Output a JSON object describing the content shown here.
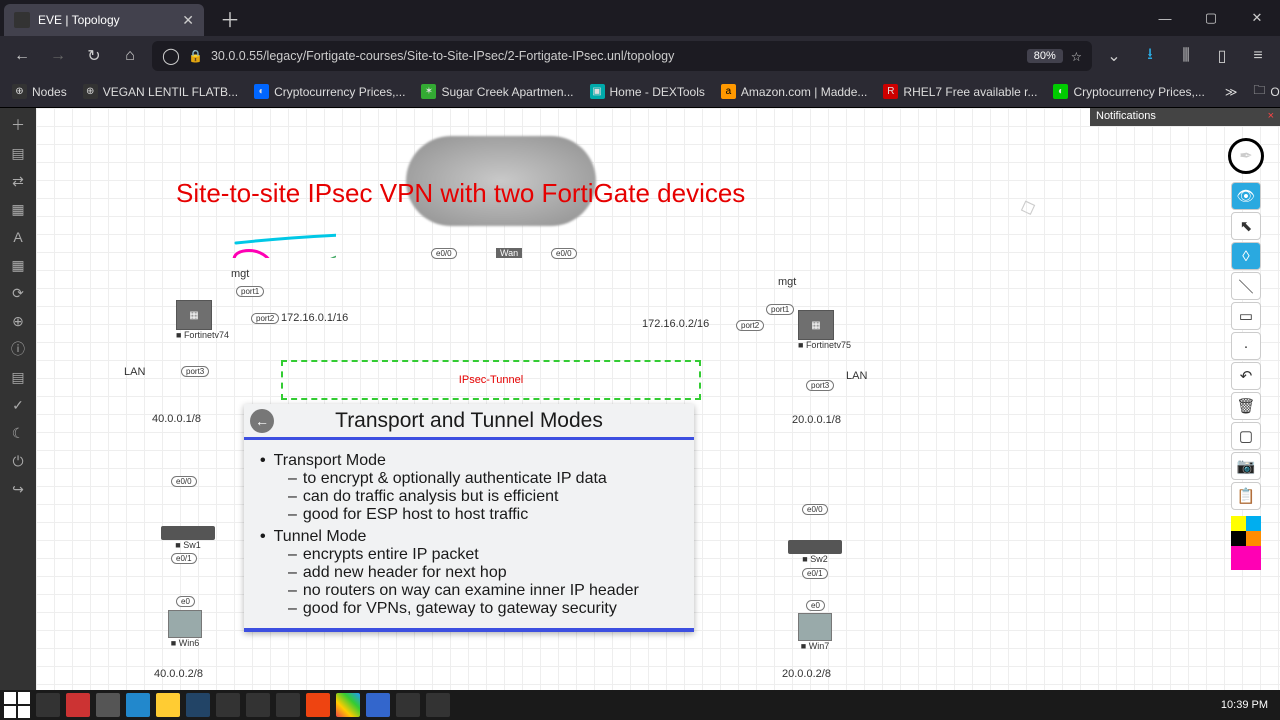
{
  "window": {
    "min": "—",
    "max": "▢",
    "close": "✕"
  },
  "tab": {
    "title": "EVE | Topology"
  },
  "nav": {
    "back": "←",
    "fwd": "→",
    "reload": "↻",
    "home": "⌂"
  },
  "url": "30.0.0.55/legacy/Fortigate-courses/Site-to-Site-IPsec/2-Fortigate-IPsec.unl/topology",
  "zoom": "80%",
  "tbRight": {
    "pocket": "⌄",
    "download": "⭳",
    "library": "⫼",
    "sidebar": "▯",
    "menu": "≡",
    "star": "☆",
    "shield": "◯"
  },
  "bookmarks": [
    {
      "icon": "⊕",
      "label": "Nodes"
    },
    {
      "icon": "⊕",
      "label": "VEGAN LENTIL FLATB..."
    },
    {
      "icon": "◐",
      "label": "Cryptocurrency Prices,..."
    },
    {
      "icon": "✶",
      "label": "Sugar Creek Apartmen..."
    },
    {
      "icon": "▣",
      "label": "Home - DEXTools"
    },
    {
      "icon": "a",
      "label": "Amazon.com | Madde..."
    },
    {
      "icon": "R",
      "label": "RHEL7 Free available r..."
    },
    {
      "icon": "◐",
      "label": "Cryptocurrency Prices,..."
    }
  ],
  "bookOverflow": "≫",
  "bookOther": "Other Bookmarks",
  "eveIcons": [
    "＋",
    "▤",
    "⇄",
    "▦",
    "A",
    "▦",
    "⟳",
    "⊕",
    "ⓘ",
    "▤",
    "✓",
    "☾",
    "⏻",
    "↪"
  ],
  "topology": {
    "title": "Site-to-site IPsec VPN with two FortiGate devices",
    "left": {
      "mgt": "mgt",
      "fg": "Fortinetv74",
      "ip": "172.16.0.1/16",
      "lan": "LAN",
      "gw": "40.0.0.1/8",
      "sw": "Sw1",
      "pc": "Win6",
      "pcip": "40.0.0.2/8",
      "port1": "port1",
      "port2": "port2",
      "port3": "port3",
      "e00": "e0/0",
      "e01": "e0/1",
      "e0": "e0"
    },
    "right": {
      "mgt": "mgt",
      "fg": "Fortinetv75",
      "ip": "172.16.0.2/16",
      "lan": "LAN",
      "gw": "20.0.0.1/8",
      "sw": "Sw2",
      "pc": "Win7",
      "pcip": "20.0.0.2/8",
      "port1": "port1",
      "port2": "port2",
      "port3": "port3",
      "e00": "e0/0",
      "e01": "e0/1",
      "e0": "e0"
    },
    "wan": "Wan",
    "e00c": "e0/0",
    "tunnel": "IPsec-Tunnel"
  },
  "modes": {
    "title": "Transport and Tunnel Modes",
    "l1": "Transport Mode",
    "l1a": "to encrypt & optionally authenticate IP data",
    "l1b": "can do traffic analysis but is efficient",
    "l1c": "good for ESP host to host traffic",
    "l2": "Tunnel Mode",
    "l2a": "encrypts entire IP packet",
    "l2b": "add new header for next hop",
    "l2c": "no routers on way can examine inner IP header",
    "l2d": "good for VPNs, gateway to gateway security"
  },
  "notifications": {
    "title": "Notifications",
    "close": "×"
  },
  "drawTools": [
    "👁",
    "⬉",
    "◊",
    "＼",
    "▭",
    "·",
    "↶",
    "🗑",
    "▢",
    "📷",
    "📋"
  ],
  "palette": [
    "#ffff00",
    "#00aeef",
    "#000000",
    "#ff8c00",
    "#ff00b4",
    "#ff00b4"
  ],
  "clock": "10:39 PM",
  "annotations": {
    "colors": {
      "magenta": "#ff00b4",
      "cyan": "#00c8e6"
    }
  }
}
